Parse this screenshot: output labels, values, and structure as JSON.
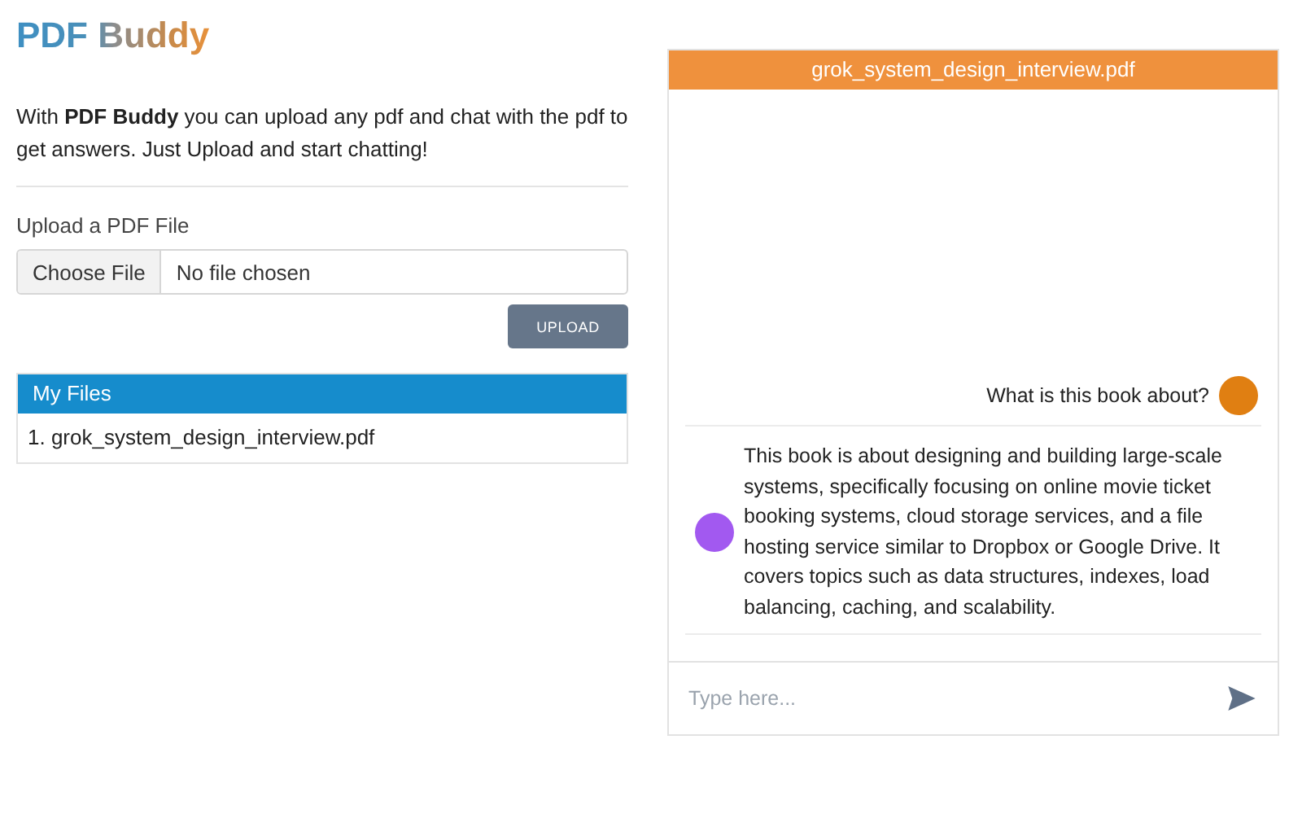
{
  "app_title": "PDF Buddy",
  "intro": "With **PDF Buddy** you can upload any pdf and chat with the pdf to get answers. Just Upload and start chatting!",
  "upload": {
    "label": "Upload a PDF File",
    "choose_button": "Choose File",
    "file_status": "No file chosen",
    "upload_button": "UPLOAD"
  },
  "files": {
    "title": "My Files",
    "items": [
      "1. grok_system_design_interview.pdf"
    ]
  },
  "chat": {
    "title": "grok_system_design_interview.pdf",
    "messages": [
      {
        "kind": "user",
        "color": "#e07f12",
        "text": "What is this book about?"
      },
      {
        "kind": "bot",
        "color": "#a259f0",
        "text": "This book is about designing and building large-scale systems, specifically focusing on online movie ticket booking systems, cloud storage services, and a file hosting service similar to Dropbox or Google Drive. It covers topics such as data structures, indexes, load balancing, caching, and scalability."
      }
    ],
    "input": {
      "placeholder": "Type here..."
    }
  }
}
